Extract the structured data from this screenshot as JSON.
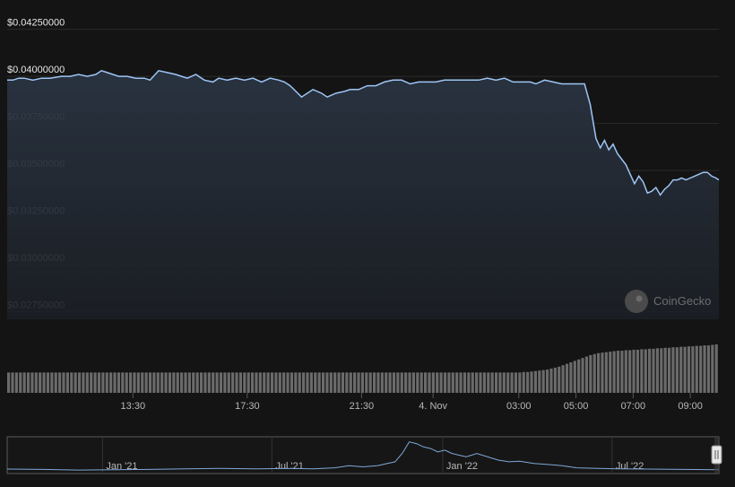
{
  "chart_data": {
    "type": "area",
    "currency": "$",
    "y_ticks": [
      "$0.04250000",
      "$0.04000000",
      "$0.03750000",
      "$0.03500000",
      "$0.03250000",
      "$0.03000000",
      "$0.02750000"
    ],
    "y_tick_values": [
      0.0425,
      0.04,
      0.0375,
      0.035,
      0.0325,
      0.03,
      0.0275
    ],
    "ylim": [
      0.0271,
      0.0431
    ],
    "x_ticks": [
      "13:30",
      "17:30",
      "21:30",
      "4. Nov",
      "03:00",
      "05:00",
      "07:00",
      "09:00"
    ],
    "x_tick_hours": [
      13.5,
      17.5,
      21.5,
      24,
      27,
      29,
      31,
      33
    ],
    "xlim": [
      9.1,
      34.0
    ],
    "price": [
      [
        9.1,
        0.0398
      ],
      [
        9.3,
        0.0398
      ],
      [
        9.5,
        0.0399
      ],
      [
        9.7,
        0.0399
      ],
      [
        10.0,
        0.0398
      ],
      [
        10.3,
        0.0399
      ],
      [
        10.6,
        0.0399
      ],
      [
        11.0,
        0.04
      ],
      [
        11.3,
        0.04
      ],
      [
        11.6,
        0.0401
      ],
      [
        11.9,
        0.04
      ],
      [
        12.2,
        0.0401
      ],
      [
        12.4,
        0.0403
      ],
      [
        12.6,
        0.0402
      ],
      [
        12.8,
        0.0401
      ],
      [
        13.0,
        0.04
      ],
      [
        13.3,
        0.04
      ],
      [
        13.6,
        0.0399
      ],
      [
        13.9,
        0.0399
      ],
      [
        14.1,
        0.0398
      ],
      [
        14.4,
        0.0403
      ],
      [
        14.7,
        0.0402
      ],
      [
        15.0,
        0.0401
      ],
      [
        15.2,
        0.04
      ],
      [
        15.4,
        0.0399
      ],
      [
        15.7,
        0.0401
      ],
      [
        16.0,
        0.0398
      ],
      [
        16.3,
        0.0397
      ],
      [
        16.5,
        0.0399
      ],
      [
        16.8,
        0.0398
      ],
      [
        17.1,
        0.0399
      ],
      [
        17.4,
        0.0398
      ],
      [
        17.7,
        0.0399
      ],
      [
        18.0,
        0.0397
      ],
      [
        18.3,
        0.0399
      ],
      [
        18.6,
        0.0398
      ],
      [
        18.8,
        0.0397
      ],
      [
        19.0,
        0.0395
      ],
      [
        19.2,
        0.0392
      ],
      [
        19.4,
        0.0389
      ],
      [
        19.6,
        0.0391
      ],
      [
        19.8,
        0.0393
      ],
      [
        20.1,
        0.0391
      ],
      [
        20.3,
        0.0389
      ],
      [
        20.6,
        0.0391
      ],
      [
        20.9,
        0.0392
      ],
      [
        21.1,
        0.0393
      ],
      [
        21.4,
        0.0393
      ],
      [
        21.7,
        0.0395
      ],
      [
        22.0,
        0.0395
      ],
      [
        22.3,
        0.0397
      ],
      [
        22.6,
        0.0398
      ],
      [
        22.9,
        0.0398
      ],
      [
        23.2,
        0.0396
      ],
      [
        23.5,
        0.0397
      ],
      [
        23.8,
        0.0397
      ],
      [
        24.1,
        0.0397
      ],
      [
        24.4,
        0.0398
      ],
      [
        24.7,
        0.0398
      ],
      [
        25.0,
        0.0398
      ],
      [
        25.3,
        0.0398
      ],
      [
        25.6,
        0.0398
      ],
      [
        25.9,
        0.0399
      ],
      [
        26.2,
        0.0398
      ],
      [
        26.5,
        0.0399
      ],
      [
        26.8,
        0.0397
      ],
      [
        27.1,
        0.0397
      ],
      [
        27.4,
        0.0397
      ],
      [
        27.6,
        0.0396
      ],
      [
        27.9,
        0.0398
      ],
      [
        28.2,
        0.0397
      ],
      [
        28.5,
        0.0396
      ],
      [
        28.8,
        0.0396
      ],
      [
        29.1,
        0.0396
      ],
      [
        29.3,
        0.0396
      ],
      [
        29.5,
        0.0385
      ],
      [
        29.7,
        0.0367
      ],
      [
        29.85,
        0.0362
      ],
      [
        30.0,
        0.0366
      ],
      [
        30.15,
        0.0361
      ],
      [
        30.3,
        0.0364
      ],
      [
        30.45,
        0.0359
      ],
      [
        30.6,
        0.0356
      ],
      [
        30.75,
        0.0353
      ],
      [
        30.9,
        0.0348
      ],
      [
        31.05,
        0.0343
      ],
      [
        31.2,
        0.0347
      ],
      [
        31.35,
        0.0344
      ],
      [
        31.5,
        0.0338
      ],
      [
        31.65,
        0.0339
      ],
      [
        31.8,
        0.0341
      ],
      [
        31.95,
        0.0337
      ],
      [
        32.1,
        0.034
      ],
      [
        32.25,
        0.0342
      ],
      [
        32.4,
        0.0345
      ],
      [
        32.55,
        0.0345
      ],
      [
        32.7,
        0.0346
      ],
      [
        32.85,
        0.0345
      ],
      [
        33.0,
        0.0346
      ],
      [
        33.15,
        0.0347
      ],
      [
        33.3,
        0.0348
      ],
      [
        33.45,
        0.0349
      ],
      [
        33.6,
        0.0349
      ],
      [
        33.75,
        0.0347
      ],
      [
        33.9,
        0.0346
      ],
      [
        34.0,
        0.0345
      ]
    ],
    "volume_relative": [
      0.42,
      0.42,
      0.42,
      0.42,
      0.42,
      0.42,
      0.42,
      0.42,
      0.42,
      0.42,
      0.42,
      0.42,
      0.42,
      0.42,
      0.42,
      0.42,
      0.42,
      0.42,
      0.42,
      0.42,
      0.42,
      0.42,
      0.42,
      0.42,
      0.42,
      0.42,
      0.42,
      0.42,
      0.42,
      0.42,
      0.42,
      0.42,
      0.42,
      0.42,
      0.42,
      0.42,
      0.42,
      0.42,
      0.42,
      0.42,
      0.42,
      0.42,
      0.42,
      0.42,
      0.42,
      0.42,
      0.42,
      0.42,
      0.42,
      0.42,
      0.42,
      0.42,
      0.42,
      0.42,
      0.42,
      0.42,
      0.42,
      0.42,
      0.42,
      0.42,
      0.42,
      0.42,
      0.42,
      0.42,
      0.42,
      0.42,
      0.42,
      0.42,
      0.42,
      0.42,
      0.42,
      0.42,
      0.42,
      0.42,
      0.42,
      0.42,
      0.42,
      0.42,
      0.42,
      0.42,
      0.42,
      0.42,
      0.42,
      0.42,
      0.42,
      0.42,
      0.42,
      0.42,
      0.42,
      0.42,
      0.42,
      0.42,
      0.42,
      0.42,
      0.42,
      0.42,
      0.42,
      0.42,
      0.42,
      0.42,
      0.42,
      0.42,
      0.42,
      0.42,
      0.42,
      0.42,
      0.42,
      0.42,
      0.42,
      0.42,
      0.42,
      0.42,
      0.42,
      0.42,
      0.42,
      0.42,
      0.42,
      0.42,
      0.42,
      0.42,
      0.42,
      0.42,
      0.42,
      0.42,
      0.42,
      0.42,
      0.42,
      0.42,
      0.42,
      0.42,
      0.42,
      0.43,
      0.43,
      0.44,
      0.45,
      0.46,
      0.47,
      0.48,
      0.5,
      0.52,
      0.54,
      0.57,
      0.6,
      0.63,
      0.66,
      0.69,
      0.72,
      0.75,
      0.78,
      0.8,
      0.82,
      0.83,
      0.84,
      0.85,
      0.86,
      0.87,
      0.87,
      0.88,
      0.88,
      0.89,
      0.89,
      0.9,
      0.9,
      0.91,
      0.91,
      0.92,
      0.92,
      0.93,
      0.93,
      0.94,
      0.94,
      0.95,
      0.95,
      0.96,
      0.96,
      0.97,
      0.97,
      0.98,
      0.98,
      0.99,
      1.0
    ],
    "navigator": {
      "x_ticks": [
        "Jan '21",
        "Jul '21",
        "Jan '22",
        "Jul '22"
      ],
      "x_tick_pos": [
        0.134,
        0.372,
        0.612,
        0.85
      ],
      "series_relative": [
        [
          0,
          0.08
        ],
        [
          0.05,
          0.07
        ],
        [
          0.1,
          0.05
        ],
        [
          0.15,
          0.06
        ],
        [
          0.2,
          0.07
        ],
        [
          0.25,
          0.09
        ],
        [
          0.3,
          0.1
        ],
        [
          0.35,
          0.09
        ],
        [
          0.4,
          0.1
        ],
        [
          0.43,
          0.09
        ],
        [
          0.46,
          0.12
        ],
        [
          0.48,
          0.18
        ],
        [
          0.5,
          0.15
        ],
        [
          0.52,
          0.18
        ],
        [
          0.545,
          0.3
        ],
        [
          0.555,
          0.55
        ],
        [
          0.565,
          0.9
        ],
        [
          0.575,
          0.85
        ],
        [
          0.585,
          0.75
        ],
        [
          0.595,
          0.7
        ],
        [
          0.605,
          0.6
        ],
        [
          0.615,
          0.65
        ],
        [
          0.625,
          0.55
        ],
        [
          0.635,
          0.5
        ],
        [
          0.645,
          0.45
        ],
        [
          0.66,
          0.55
        ],
        [
          0.675,
          0.45
        ],
        [
          0.69,
          0.35
        ],
        [
          0.705,
          0.3
        ],
        [
          0.72,
          0.32
        ],
        [
          0.74,
          0.25
        ],
        [
          0.76,
          0.22
        ],
        [
          0.78,
          0.18
        ],
        [
          0.8,
          0.12
        ],
        [
          0.83,
          0.1
        ],
        [
          0.86,
          0.09
        ],
        [
          0.9,
          0.08
        ],
        [
          0.95,
          0.07
        ],
        [
          1.0,
          0.06
        ]
      ]
    },
    "watermark": "CoinGecko",
    "colors": {
      "line": "#9ec5f5",
      "background": "#141414",
      "grid": "#2a2a2a",
      "volume": "#6b6b6b",
      "navigator_line": "#7fa7d8"
    }
  }
}
